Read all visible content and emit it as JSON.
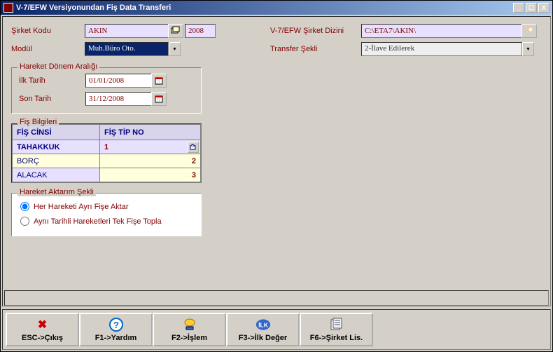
{
  "window": {
    "title": "V-7/EFW Versiyonundan Fiş Data Transferi",
    "min": "_",
    "max": "☐",
    "close": "X"
  },
  "form": {
    "sirket_kodu_label": "Şirket Kodu",
    "sirket_kodu": "AKIN",
    "year": "2008",
    "modul_label": "Modül",
    "modul": "Muh.Büro Oto.",
    "sirket_dizini_label": "V-7/EFW Şirket Dizini",
    "sirket_dizini": "C:\\ETA7\\AKIN\\",
    "transfer_sekli_label": "Transfer Şekli",
    "transfer_sekli": "2-İlave Edilerek"
  },
  "donem": {
    "title": "Hareket Dönem Aralığı",
    "ilk_label": "İlk Tarih",
    "ilk": "01/01/2008",
    "son_label": "Son Tarih",
    "son": "31/12/2008"
  },
  "fis": {
    "title": "Fiş Bilgileri",
    "colA": "FİŞ CİNSİ",
    "colB": "FİŞ TİP NO",
    "rows": {
      "r1a": "TAHAKKUK",
      "r1b": "1",
      "r2a": "BORÇ",
      "r2b": "2",
      "r3a": "ALACAK",
      "r3b": "3"
    }
  },
  "aktarim": {
    "title": "Hareket Aktarım Şekli",
    "opt1": "Her Hareketi Ayrı Fişe Aktar",
    "opt2": "Aynı Tarihli Hareketleri Tek Fişe Topla"
  },
  "toolbar": {
    "esc": "ESC->Çıkış",
    "f1": "F1->Yardım",
    "f2": "F2->İşlem",
    "f3": "F3->İlk Değer",
    "f6": "F6->Şirket Lis."
  },
  "icons": {
    "ilk_badge": "İLK"
  }
}
